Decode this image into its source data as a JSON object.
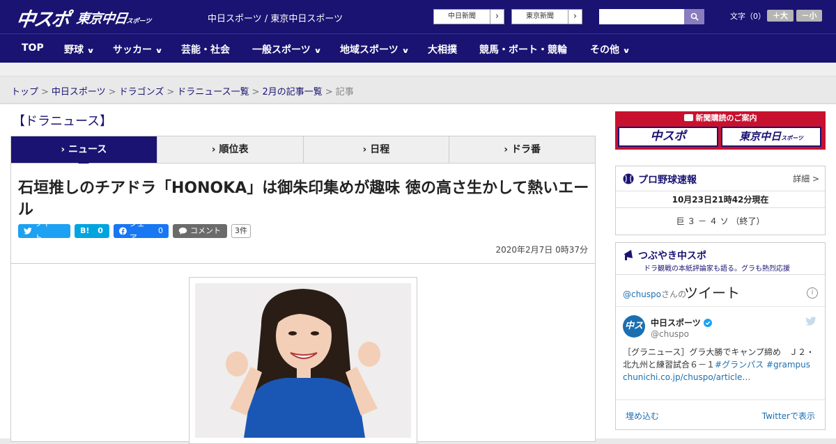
{
  "header": {
    "logo_chuspo": "中スポ",
    "logo_tokyo": "東京中日",
    "logo_tokyo_small": "スポーツ",
    "site_name": "中日スポーツ / 東京中日スポーツ",
    "ext_links": [
      "中日新聞",
      "東京新聞"
    ],
    "font_label": "文字（0）",
    "font_bigger": "＋大",
    "font_smaller": "－小"
  },
  "nav": {
    "items": [
      {
        "label": "TOP",
        "has_dropdown": false
      },
      {
        "label": "野球",
        "has_dropdown": true
      },
      {
        "label": "サッカー",
        "has_dropdown": true
      },
      {
        "label": "芸能・社会",
        "has_dropdown": false
      },
      {
        "label": "一般スポーツ",
        "has_dropdown": true
      },
      {
        "label": "地域スポーツ",
        "has_dropdown": true
      },
      {
        "label": "大相撲",
        "has_dropdown": false
      },
      {
        "label": "競馬・ボート・競輪",
        "has_dropdown": false
      },
      {
        "label": "その他",
        "has_dropdown": true
      }
    ]
  },
  "breadcrumb": {
    "links": [
      "トップ",
      "中日スポーツ",
      "ドラゴンズ",
      "ドラニュース一覧",
      "2月の記事一覧"
    ],
    "current": "記事"
  },
  "section_title": "【ドラニュース】",
  "tabs": [
    {
      "label": "ニュース",
      "active": true
    },
    {
      "label": "順位表",
      "active": false
    },
    {
      "label": "日程",
      "active": false
    },
    {
      "label": "ドラ番",
      "active": false
    }
  ],
  "article": {
    "headline": "石垣推しのチアドラ「HONOKA」は御朱印集めが趣味 徳の高さ生かして熱いエール",
    "date": "2020年2月7日 0時37分",
    "share": {
      "tweet": "ツイート",
      "hatena": "B!",
      "hatena_count": "0",
      "facebook": "シェア",
      "facebook_count": "0",
      "comment": "コメント",
      "comment_count": "3件"
    }
  },
  "sidebar": {
    "promo": {
      "title": "新聞購読のご案内",
      "chuspo": "中スポ",
      "tokyo": "東京中日",
      "tokyo_small": "スポーツ"
    },
    "pro_baseball": {
      "title": "プロ野球速報",
      "detail": "詳細 >",
      "time": "10月23日21時42分現在",
      "score": "巨 ３ － ４ ソ （終了）"
    },
    "tweets": {
      "title": "つぶやき中スポ",
      "subtitle": "ドラ観戦の本紙評論家も語る。グラも熱烈応援",
      "handle_link": "@chuspo",
      "handle_suffix": "さんの",
      "header_big": "ツイート",
      "user_name": "中日スポーツ",
      "user_handle": "@chuspo",
      "text_plain": "［グラニュース］グラ大勝でキャンプ締め　Ｊ２・北九州と練習試合６－１",
      "hashtag1": "#グランパス",
      "hashtag2": "#grampus",
      "link": "chunichi.co.jp/chuspo/article…",
      "embed": "埋め込む",
      "view": "Twitterで表示"
    }
  },
  "colors": {
    "brand_navy": "#1a1372",
    "promo_red": "#c8112e",
    "twitter_blue": "#1da1f2",
    "facebook_blue": "#1877f2",
    "hatena_blue": "#00a4de"
  }
}
